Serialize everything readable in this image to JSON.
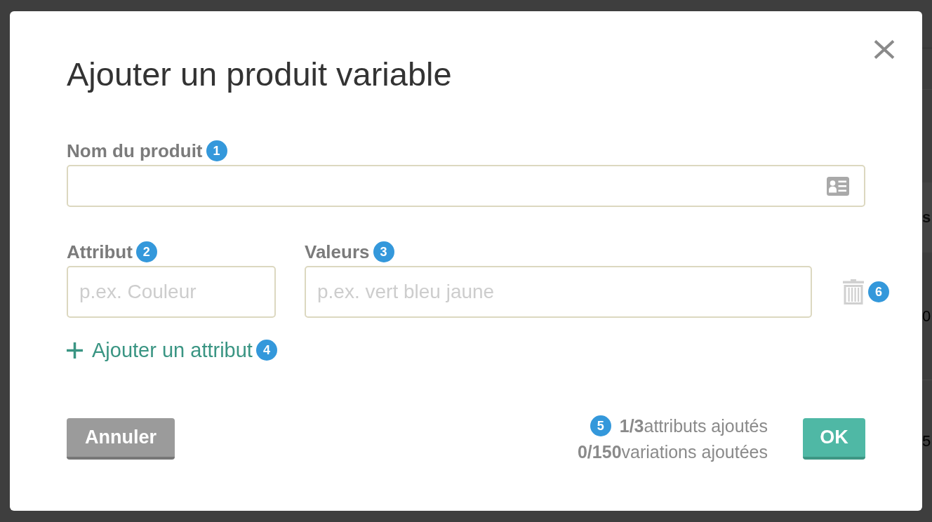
{
  "dialog": {
    "title": "Ajouter un produit variable"
  },
  "product_name": {
    "label": "Nom du produit",
    "badge": "1"
  },
  "attribute_rows": [
    {
      "attribute": {
        "label": "Attribut",
        "badge": "2",
        "placeholder": "p.ex. Couleur"
      },
      "values": {
        "label": "Valeurs",
        "badge": "3",
        "placeholder": "p.ex. vert bleu jaune"
      },
      "delete_badge": "6"
    }
  ],
  "add_attribute": {
    "label": "Ajouter un attribut",
    "badge": "4"
  },
  "footer": {
    "cancel": "Annuler",
    "stats": [
      {
        "badge": "5",
        "text": "**1/3**attributs ajoutés"
      },
      {
        "text": "**0/150**variations ajoutées"
      }
    ],
    "ok": "OK"
  },
  "backdrop": {
    "fragments": [
      {
        "kind": "heading",
        "text": "s"
      },
      {
        "kind": "cell",
        "text": "0"
      },
      {
        "kind": "cell",
        "text": "5"
      }
    ]
  }
}
